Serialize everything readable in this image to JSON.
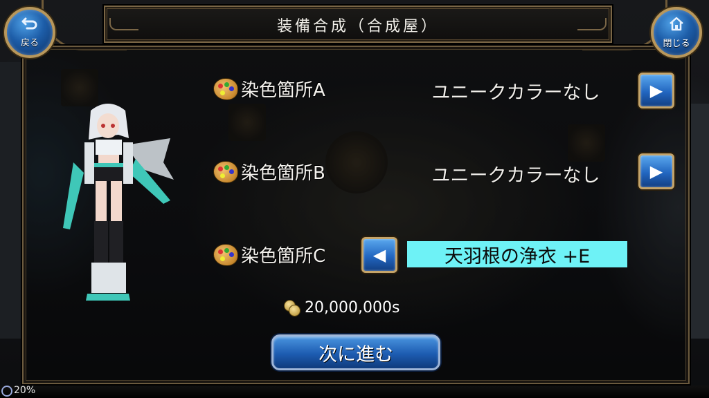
{
  "header": {
    "title": "装備合成（合成屋）",
    "back_label": "戻る",
    "close_label": "閉じる"
  },
  "dye_rows": [
    {
      "label": "染色箇所A",
      "value": "ユニークカラーなし",
      "arrow": "right"
    },
    {
      "label": "染色箇所B",
      "value": "ユニークカラーなし",
      "arrow": "right"
    },
    {
      "label": "染色箇所C",
      "value": "天羽根の浄衣 +E",
      "arrow": "left"
    }
  ],
  "cost": {
    "amount": "20,000,000s"
  },
  "next_button": {
    "label": "次に進む"
  },
  "status": {
    "loading": "20%"
  },
  "colors": {
    "selected_bg": "#6ef2f6",
    "button_blue": "#2266c0",
    "frame_gold": "#b8975c"
  }
}
